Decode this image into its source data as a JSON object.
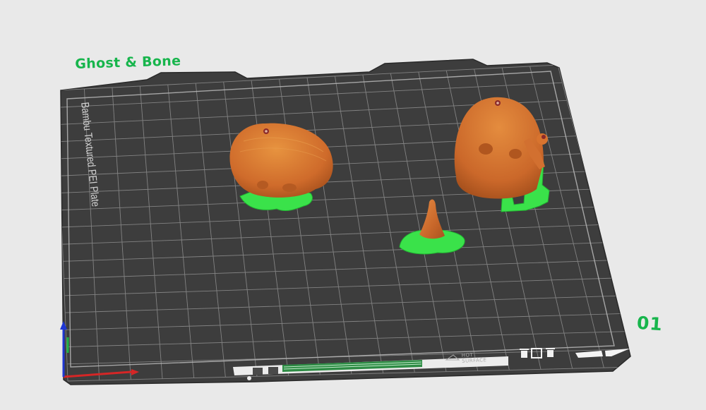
{
  "plate": {
    "title": "Ghost & Bone",
    "number": "01",
    "bed_label": "Bambu Textured PEI Plate",
    "surface_line1": "HOT",
    "surface_line2": "SURFACE"
  },
  "axes": {
    "x_color": "#d52626",
    "y_color": "#1fb545",
    "z_color": "#1f37d2"
  },
  "colors": {
    "model": "#d8742f",
    "support": "#3ae24a",
    "bed": "#3d3d3d",
    "accent": "#17b54c"
  },
  "objects": [
    {
      "name": "skull"
    },
    {
      "name": "ghost-with-bone"
    },
    {
      "name": "small-cone"
    }
  ],
  "bottom_icons": [
    "trash-icon",
    "frame-icon",
    "trash-icon"
  ]
}
